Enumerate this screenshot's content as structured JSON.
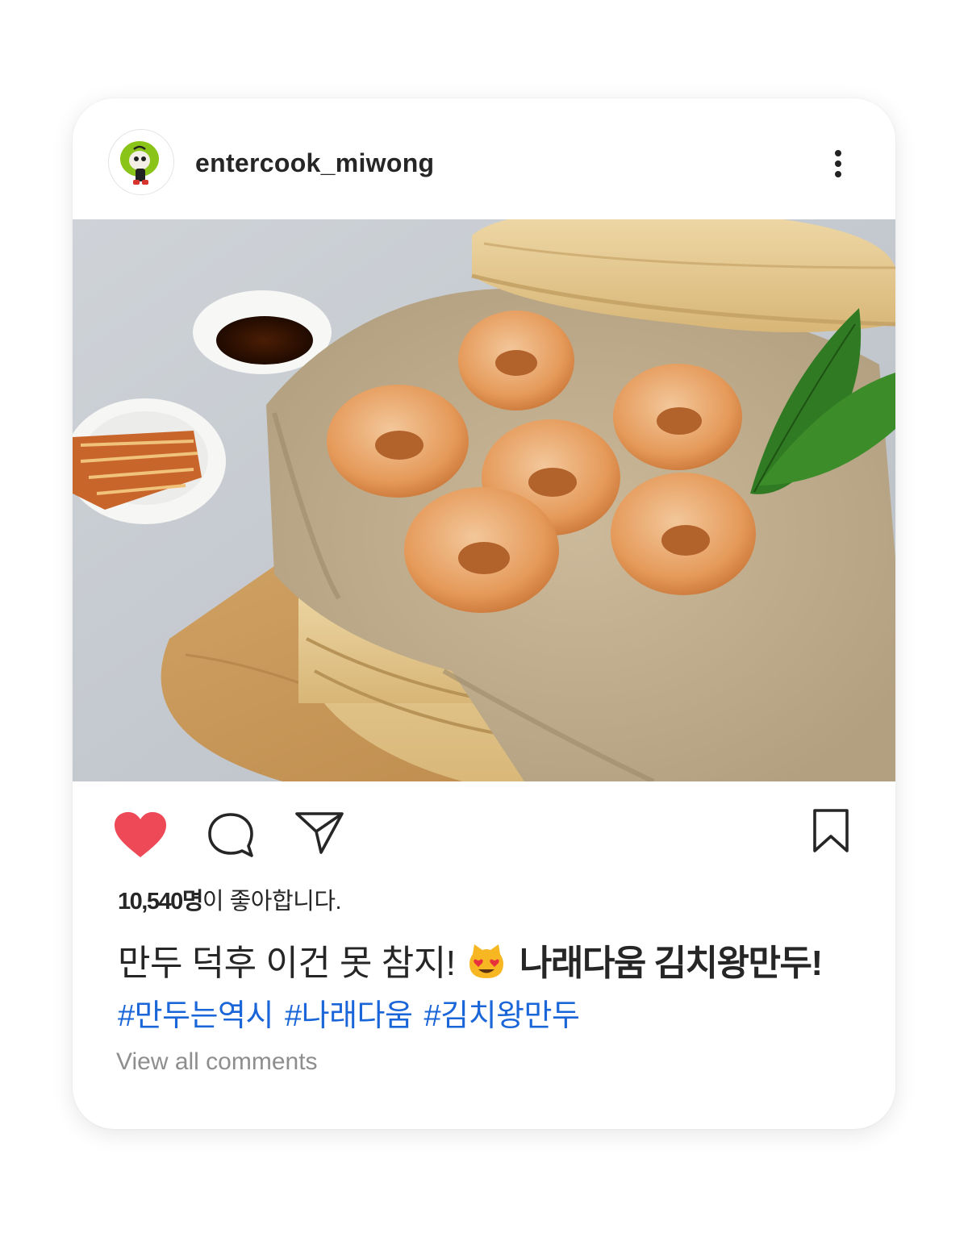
{
  "post": {
    "username": "entercook_miwong",
    "avatar_icon": "mascot-avatar-icon",
    "more_icon": "more-options-icon",
    "image_description_icon": "dumplings-photo",
    "actions": {
      "like_icon": "heart-icon",
      "like_state": "liked",
      "like_color": "#ed4956",
      "comment_icon": "comment-icon",
      "share_icon": "send-icon",
      "save_icon": "bookmark-icon"
    },
    "likes": {
      "count": "10,540명",
      "suffix": "이 좋아합니다."
    },
    "caption": {
      "text": "만두 덕후 이건 못 참지!",
      "emoji": "heart-eyes-cat-emoji",
      "brand": "나래다움 김치왕만두!"
    },
    "hashtags": [
      "#만두는역시",
      "#나래다움",
      "#김치왕만두"
    ],
    "hashtag_color": "#1a66d8",
    "view_comments": "View all comments"
  }
}
